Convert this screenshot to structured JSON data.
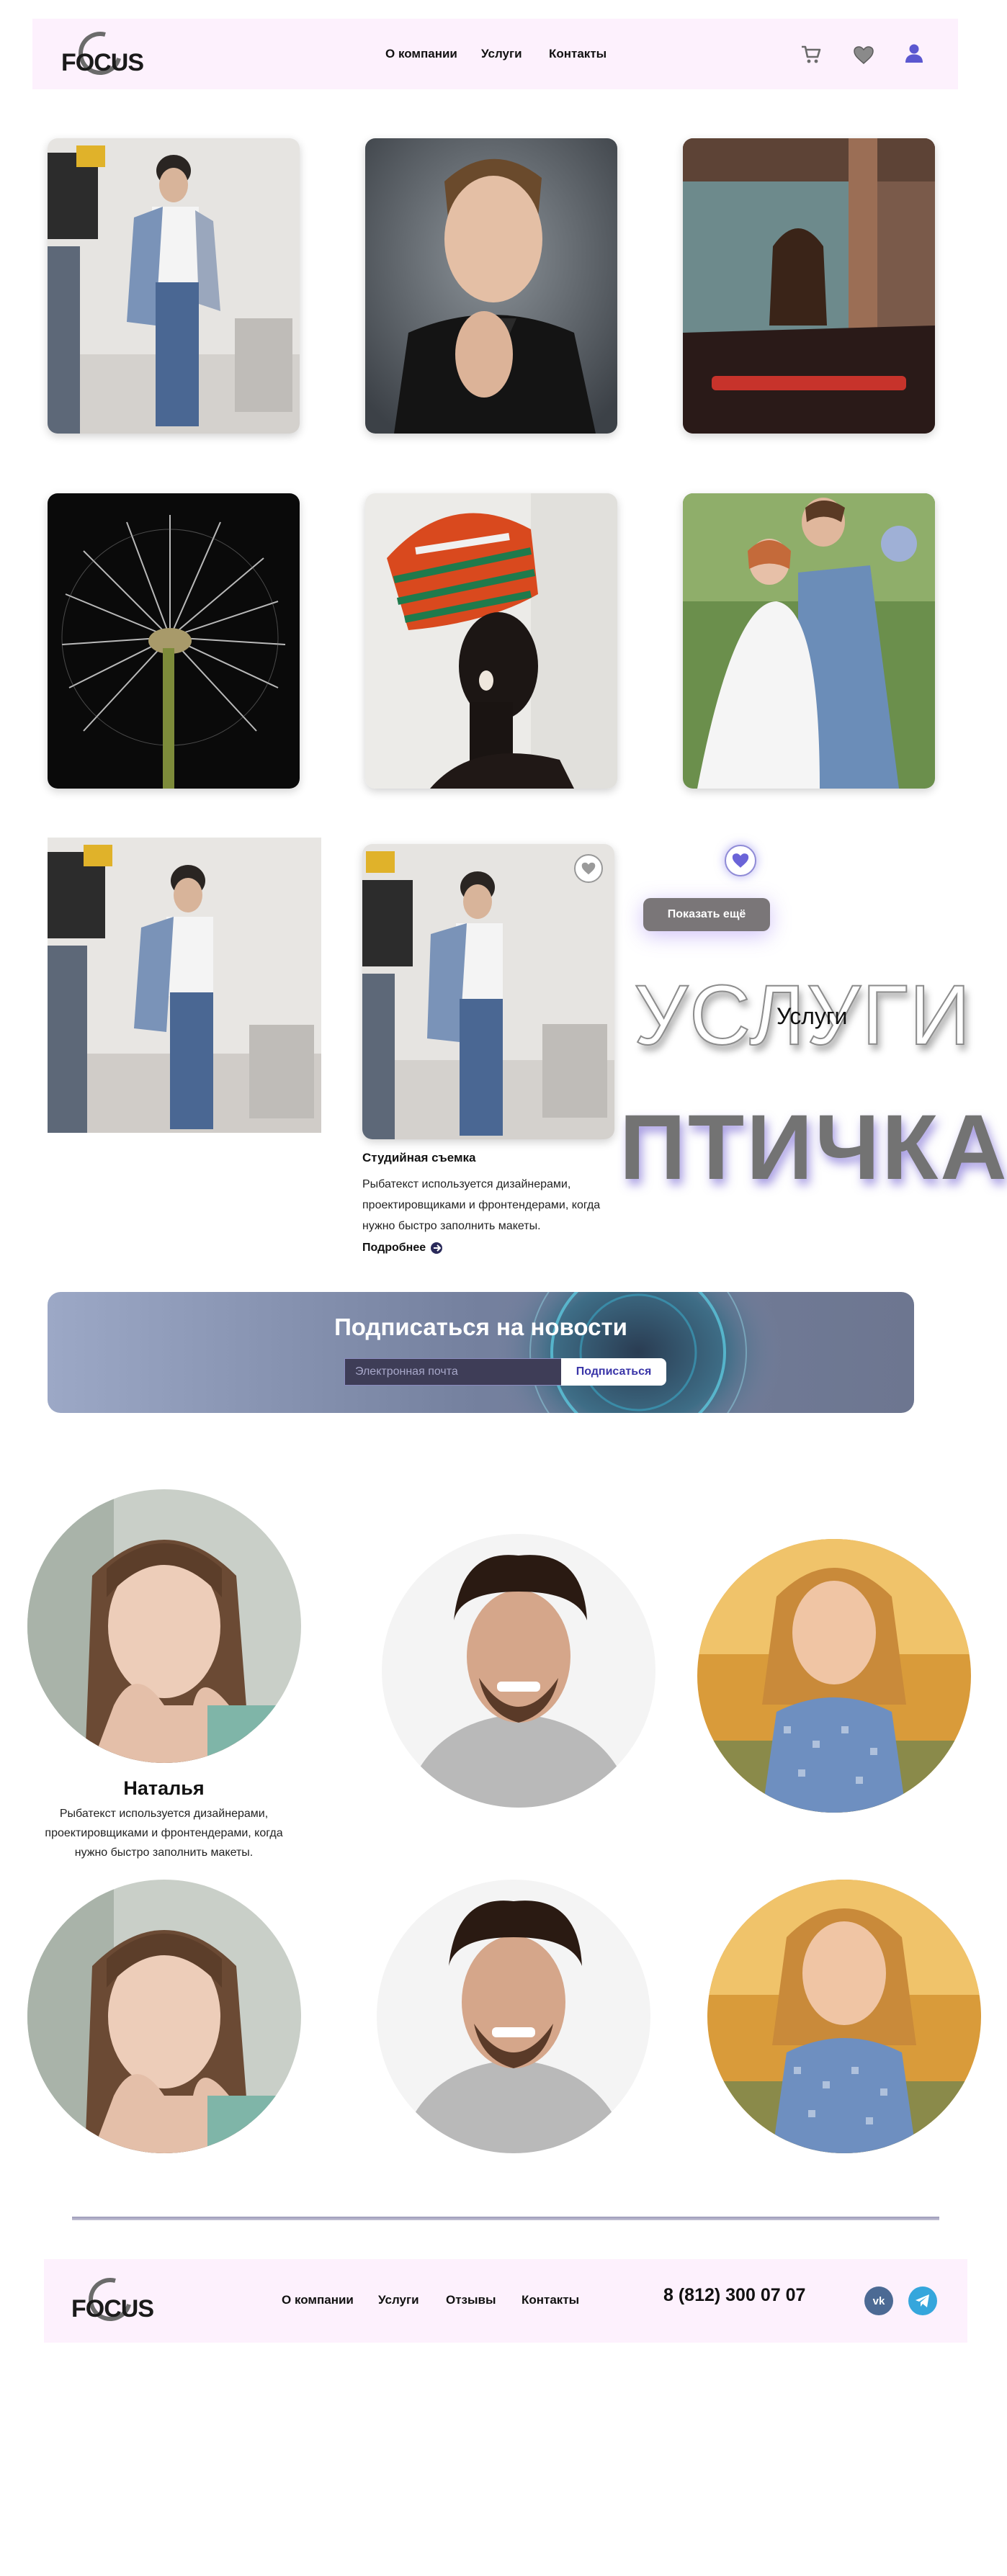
{
  "header": {
    "logo_text": "FOCUS",
    "nav": [
      "О компании",
      "Услуги",
      "Контакты"
    ],
    "icons": [
      "cart-icon",
      "heart-icon",
      "user-icon"
    ]
  },
  "gallery": {
    "show_more_label": "Показать ещё"
  },
  "services": {
    "outline_title": "УСЛУГИ",
    "title": "Услуги",
    "bird_title": "ПТИЧКА"
  },
  "card": {
    "title": "Студийная съемка",
    "text": "Рыбатекст используется дизайнерами, проектировщиками и фронтендерами, когда нужно быстро заполнить макеты.",
    "more_label": "Подробнее"
  },
  "subscribe": {
    "title": "Подписаться на новости",
    "placeholder": "Электронная почта",
    "button_label": "Подписаться"
  },
  "team": {
    "name": "Наталья",
    "text": "Рыбатекст используется дизайнерами, проектировщиками и фронтендерами, когда нужно быстро заполнить макеты."
  },
  "footer": {
    "logo_text": "FOCUS",
    "nav": [
      "О компании",
      "Услуги",
      "Отзывы",
      "Контакты"
    ],
    "phone": "8 (812) 300 07 07",
    "socials": [
      "vk-icon",
      "telegram-icon"
    ]
  },
  "colors": {
    "header_bg": "#fdf1fd",
    "accent": "#5b57d0",
    "button_gray": "#7a7678"
  }
}
